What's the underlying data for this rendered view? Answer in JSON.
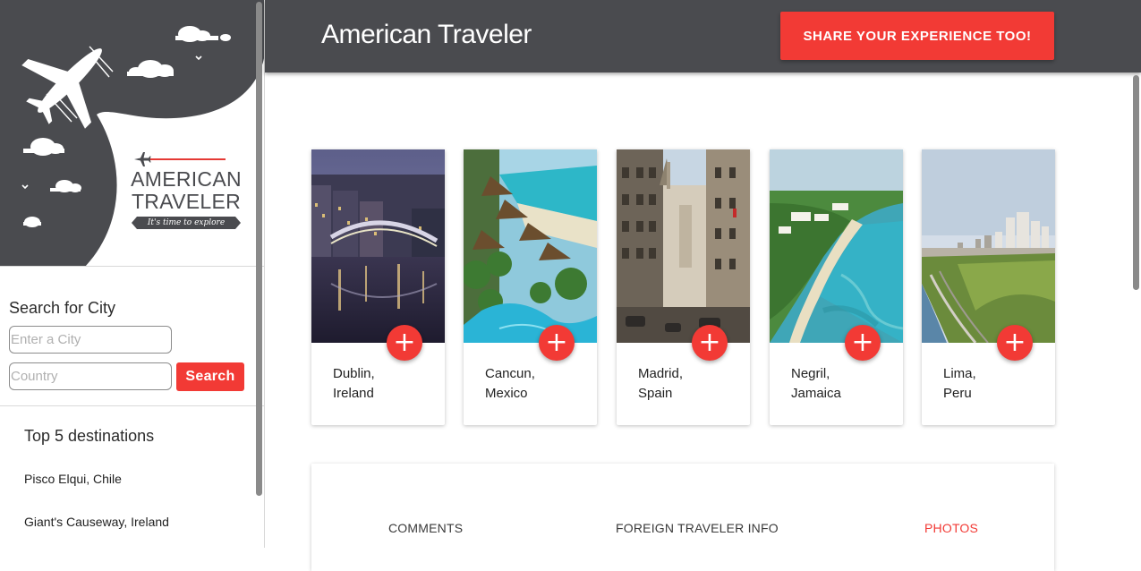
{
  "header": {
    "title": "American Traveler",
    "share_button": "SHARE YOUR EXPERIENCE TOO!"
  },
  "logo": {
    "line1": "AMERICAN",
    "line2": "TRAVELER",
    "tagline": "It's time to explore"
  },
  "search": {
    "title": "Search for City",
    "city_placeholder": "Enter a City",
    "country_placeholder": "Country",
    "button": "Search"
  },
  "top_destinations": {
    "title": "Top 5 destinations",
    "items": [
      "Pisco Elqui, Chile",
      "Giant's Causeway, Ireland"
    ]
  },
  "destinations": [
    {
      "city": "Dublin,",
      "country": "Ireland",
      "add_icon": "plus-icon"
    },
    {
      "city": "Cancun,",
      "country": "Mexico",
      "add_icon": "plus-icon"
    },
    {
      "city": "Madrid,",
      "country": "Spain",
      "add_icon": "plus-icon"
    },
    {
      "city": "Negril,",
      "country": "Jamaica",
      "add_icon": "plus-icon"
    },
    {
      "city": "Lima,",
      "country": "Peru",
      "add_icon": "plus-icon"
    }
  ],
  "tabs": [
    {
      "label": "COMMENTS",
      "active": false
    },
    {
      "label": "FOREIGN TRAVELER INFO",
      "active": false
    },
    {
      "label": "PHOTOS",
      "active": true
    }
  ],
  "colors": {
    "accent": "#f23a35",
    "header": "#4a4b4f",
    "sidebar_art": "#4a4b4f"
  }
}
